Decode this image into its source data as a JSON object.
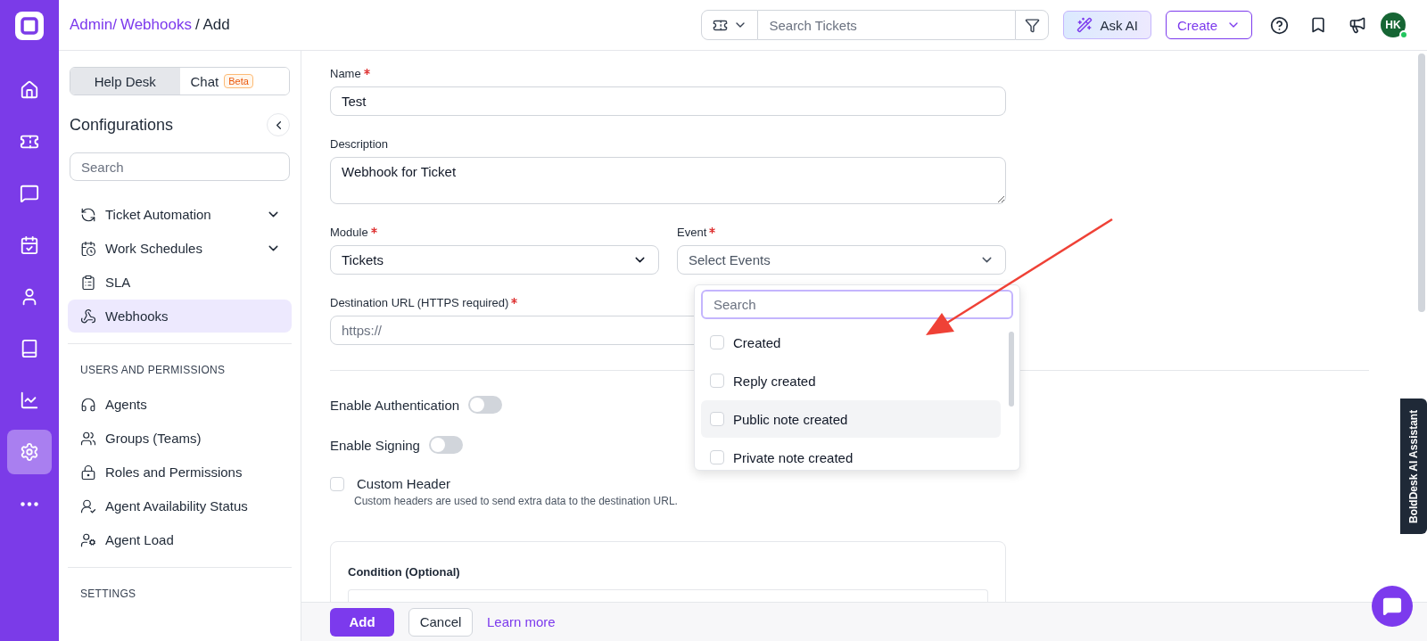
{
  "rail": {
    "items": [
      {
        "kind": "home",
        "selected": false
      },
      {
        "kind": "ticket",
        "selected": false
      },
      {
        "kind": "chat",
        "selected": false
      },
      {
        "kind": "tasks",
        "selected": false
      },
      {
        "kind": "user",
        "selected": false
      },
      {
        "kind": "book",
        "selected": false
      },
      {
        "kind": "chart",
        "selected": false
      },
      {
        "kind": "settings",
        "selected": true
      },
      {
        "kind": "more",
        "selected": false
      }
    ]
  },
  "header": {
    "breadcrumb": [
      {
        "label": "Admin/",
        "kind": "link"
      },
      {
        "label": "Webhooks",
        "kind": "link"
      },
      {
        "label": "/ Add",
        "kind": "current"
      }
    ],
    "search": {
      "placeholder": "Search Tickets"
    },
    "ask_ai": "Ask AI",
    "create": "Create",
    "avatar": {
      "initials": "HK",
      "online": true
    }
  },
  "sidebar": {
    "tabs": [
      {
        "label": "Help Desk",
        "selected": true
      },
      {
        "label": "Chat",
        "badge": "Beta",
        "selected": false
      }
    ],
    "title": "Configurations",
    "search": {
      "placeholder": "Search"
    },
    "sections": [
      {
        "items": [
          {
            "label": "Ticket Automation",
            "kind": "automation",
            "expandable": true,
            "selected": false
          },
          {
            "label": "Work Schedules",
            "kind": "schedule",
            "expandable": true,
            "selected": false
          },
          {
            "label": "SLA",
            "kind": "sla",
            "expandable": false,
            "selected": false
          },
          {
            "label": "Webhooks",
            "kind": "webhook",
            "expandable": false,
            "selected": true
          }
        ]
      },
      {
        "heading": "USERS AND PERMISSIONS",
        "items": [
          {
            "label": "Agents",
            "kind": "headphones",
            "expandable": false,
            "selected": false
          },
          {
            "label": "Groups (Teams)",
            "kind": "users",
            "expandable": false,
            "selected": false
          },
          {
            "label": "Roles and Permissions",
            "kind": "lock",
            "expandable": false,
            "selected": false
          },
          {
            "label": "Agent Availability Status",
            "kind": "status",
            "expandable": false,
            "selected": false
          },
          {
            "label": "Agent Load",
            "kind": "load",
            "expandable": false,
            "selected": false
          }
        ]
      },
      {
        "heading": "SETTINGS"
      }
    ]
  },
  "form": {
    "name": {
      "label": "Name",
      "required": true,
      "value": "Test"
    },
    "description": {
      "label": "Description",
      "value": "Webhook for Ticket"
    },
    "module": {
      "label": "Module",
      "required": true,
      "value": "Tickets"
    },
    "event": {
      "label": "Event",
      "required": true,
      "placeholder": "Select Events",
      "dropdown": {
        "search_placeholder": "Search",
        "options": [
          {
            "label": "Created",
            "checked": false,
            "highlighted": false
          },
          {
            "label": "Reply created",
            "checked": false,
            "highlighted": false
          },
          {
            "label": "Public note created",
            "checked": false,
            "highlighted": true
          },
          {
            "label": "Private note created",
            "checked": false,
            "highlighted": false
          }
        ]
      }
    },
    "destination": {
      "label": "Destination URL (HTTPS required)",
      "required": true,
      "placeholder": "https://"
    },
    "toggles": [
      {
        "label": "Enable Authentication",
        "on": false
      },
      {
        "label": "Enable Signing",
        "on": false
      }
    ],
    "custom_header": {
      "label": "Custom Header",
      "checked": false,
      "hint": "Custom headers are used to send extra data to the destination URL."
    },
    "condition": {
      "title": "Condition (Optional)"
    }
  },
  "footer": {
    "add": "Add",
    "cancel": "Cancel",
    "learn_more": "Learn more"
  },
  "assistant_tab": "BoldDesk AI Assistant"
}
